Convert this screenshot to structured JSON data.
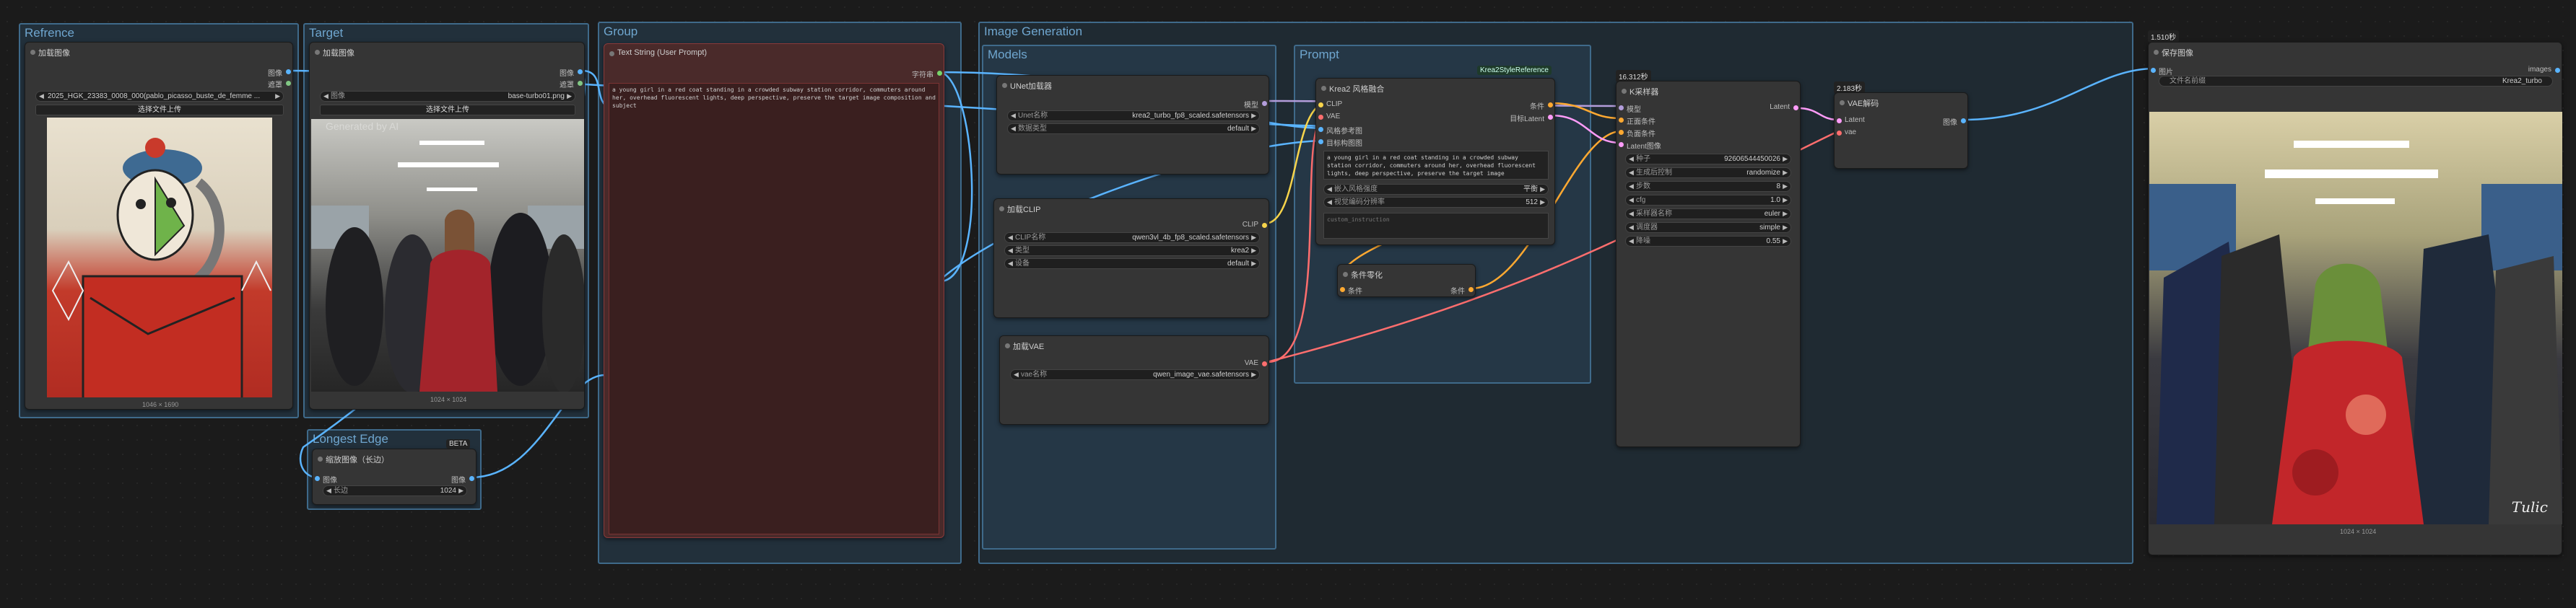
{
  "groups": {
    "reference": "Refrence",
    "target": "Target",
    "group": "Group",
    "longest_edge": "Longest Edge",
    "image_generation": "Image Generation",
    "models": "Models",
    "prompt": "Prompt"
  },
  "load_ref": {
    "title": "加载图像",
    "out_image": "图像",
    "out_mask": "遮罩",
    "filename": "2025_HGK_23383_0008_000(pablo_picasso_buste_de_femme ...",
    "upload": "选择文件上传",
    "size": "1046 × 1690"
  },
  "load_target": {
    "title": "加载图像",
    "out_image": "图像",
    "out_mask": "遮罩",
    "label": "图像",
    "filename": "base-turbo01.png",
    "upload": "选择文件上传",
    "size": "1024 × 1024",
    "watermark": "Generated by AI"
  },
  "scale": {
    "title": "缩放图像（长边）",
    "badge": "BETA",
    "in_image": "图像",
    "out_image": "图像",
    "label": "长边",
    "value": "1024"
  },
  "text_string": {
    "title": "Text String (User Prompt)",
    "out": "字符串",
    "text": "a young girl in a red coat standing in a crowded subway station corridor, commuters around her, overhead fluorescent lights, deep perspective, preserve the target image composition and subject"
  },
  "unet": {
    "title": "UNet加载器",
    "out": "模型",
    "label1": "Unet名称",
    "value1": "krea2_turbo_fp8_scaled.safetensors",
    "label2": "数据类型",
    "value2": "default"
  },
  "clip": {
    "title": "加载CLIP",
    "out": "CLIP",
    "label1": "CLIP名称",
    "value1": "qwen3vl_4b_fp8_scaled.safetensors",
    "label2": "类型",
    "value2": "krea2",
    "label3": "设备",
    "value3": "default"
  },
  "vae": {
    "title": "加载VAE",
    "out": "VAE",
    "label1": "vae名称",
    "value1": "qwen_image_vae.safetensors"
  },
  "style": {
    "title": "Krea2 风格融合",
    "badge": "Krea2StyleReference",
    "in1": "CLIP",
    "in2": "VAE",
    "in3": "风格参考图",
    "in4": "目标构图图",
    "out1": "条件",
    "out2": "目标Latent",
    "text": "a young girl in a red coat standing in a crowded subway station corridor, commuters around her, overhead fluorescent lights, deep perspective, preserve the target image composition and subject",
    "label1": "嵌入风格强度",
    "value1": "平衡",
    "label2": "视觉编码分辨率",
    "value2": "512",
    "custom": "custom_instruction"
  },
  "zero": {
    "title": "条件零化",
    "in": "条件",
    "out": "条件"
  },
  "ksampler": {
    "timer": "16.312秒",
    "title": "K采样器",
    "in1": "模型",
    "in2": "正面条件",
    "in3": "负面条件",
    "in4": "Latent图像",
    "out": "Latent",
    "rows": [
      {
        "label": "种子",
        "value": "92606544450026"
      },
      {
        "label": "生成后控制",
        "value": "randomize"
      },
      {
        "label": "步数",
        "value": "8"
      },
      {
        "label": "cfg",
        "value": "1.0"
      },
      {
        "label": "采样器名称",
        "value": "euler"
      },
      {
        "label": "调度器",
        "value": "simple"
      },
      {
        "label": "降噪",
        "value": "0.55"
      }
    ]
  },
  "vaedecode": {
    "timer": "2.183秒",
    "title": "VAE解码",
    "in1": "Latent",
    "in2": "vae",
    "out": "图像"
  },
  "save": {
    "timer": "1.510秒",
    "title": "保存图像",
    "in": "图片",
    "out": "images",
    "label": "文件名前缀",
    "value": "Krea2_turbo",
    "size": "1024 × 1024",
    "signature": "Tulic"
  },
  "colors": {
    "image_wire": "#5ab4ff",
    "clip_wire": "#f7d44b",
    "vae_wire": "#ff6e6e",
    "model_wire": "#b39ddb",
    "cond_wire": "#ffa931",
    "latent_wire": "#ff9cf9"
  }
}
